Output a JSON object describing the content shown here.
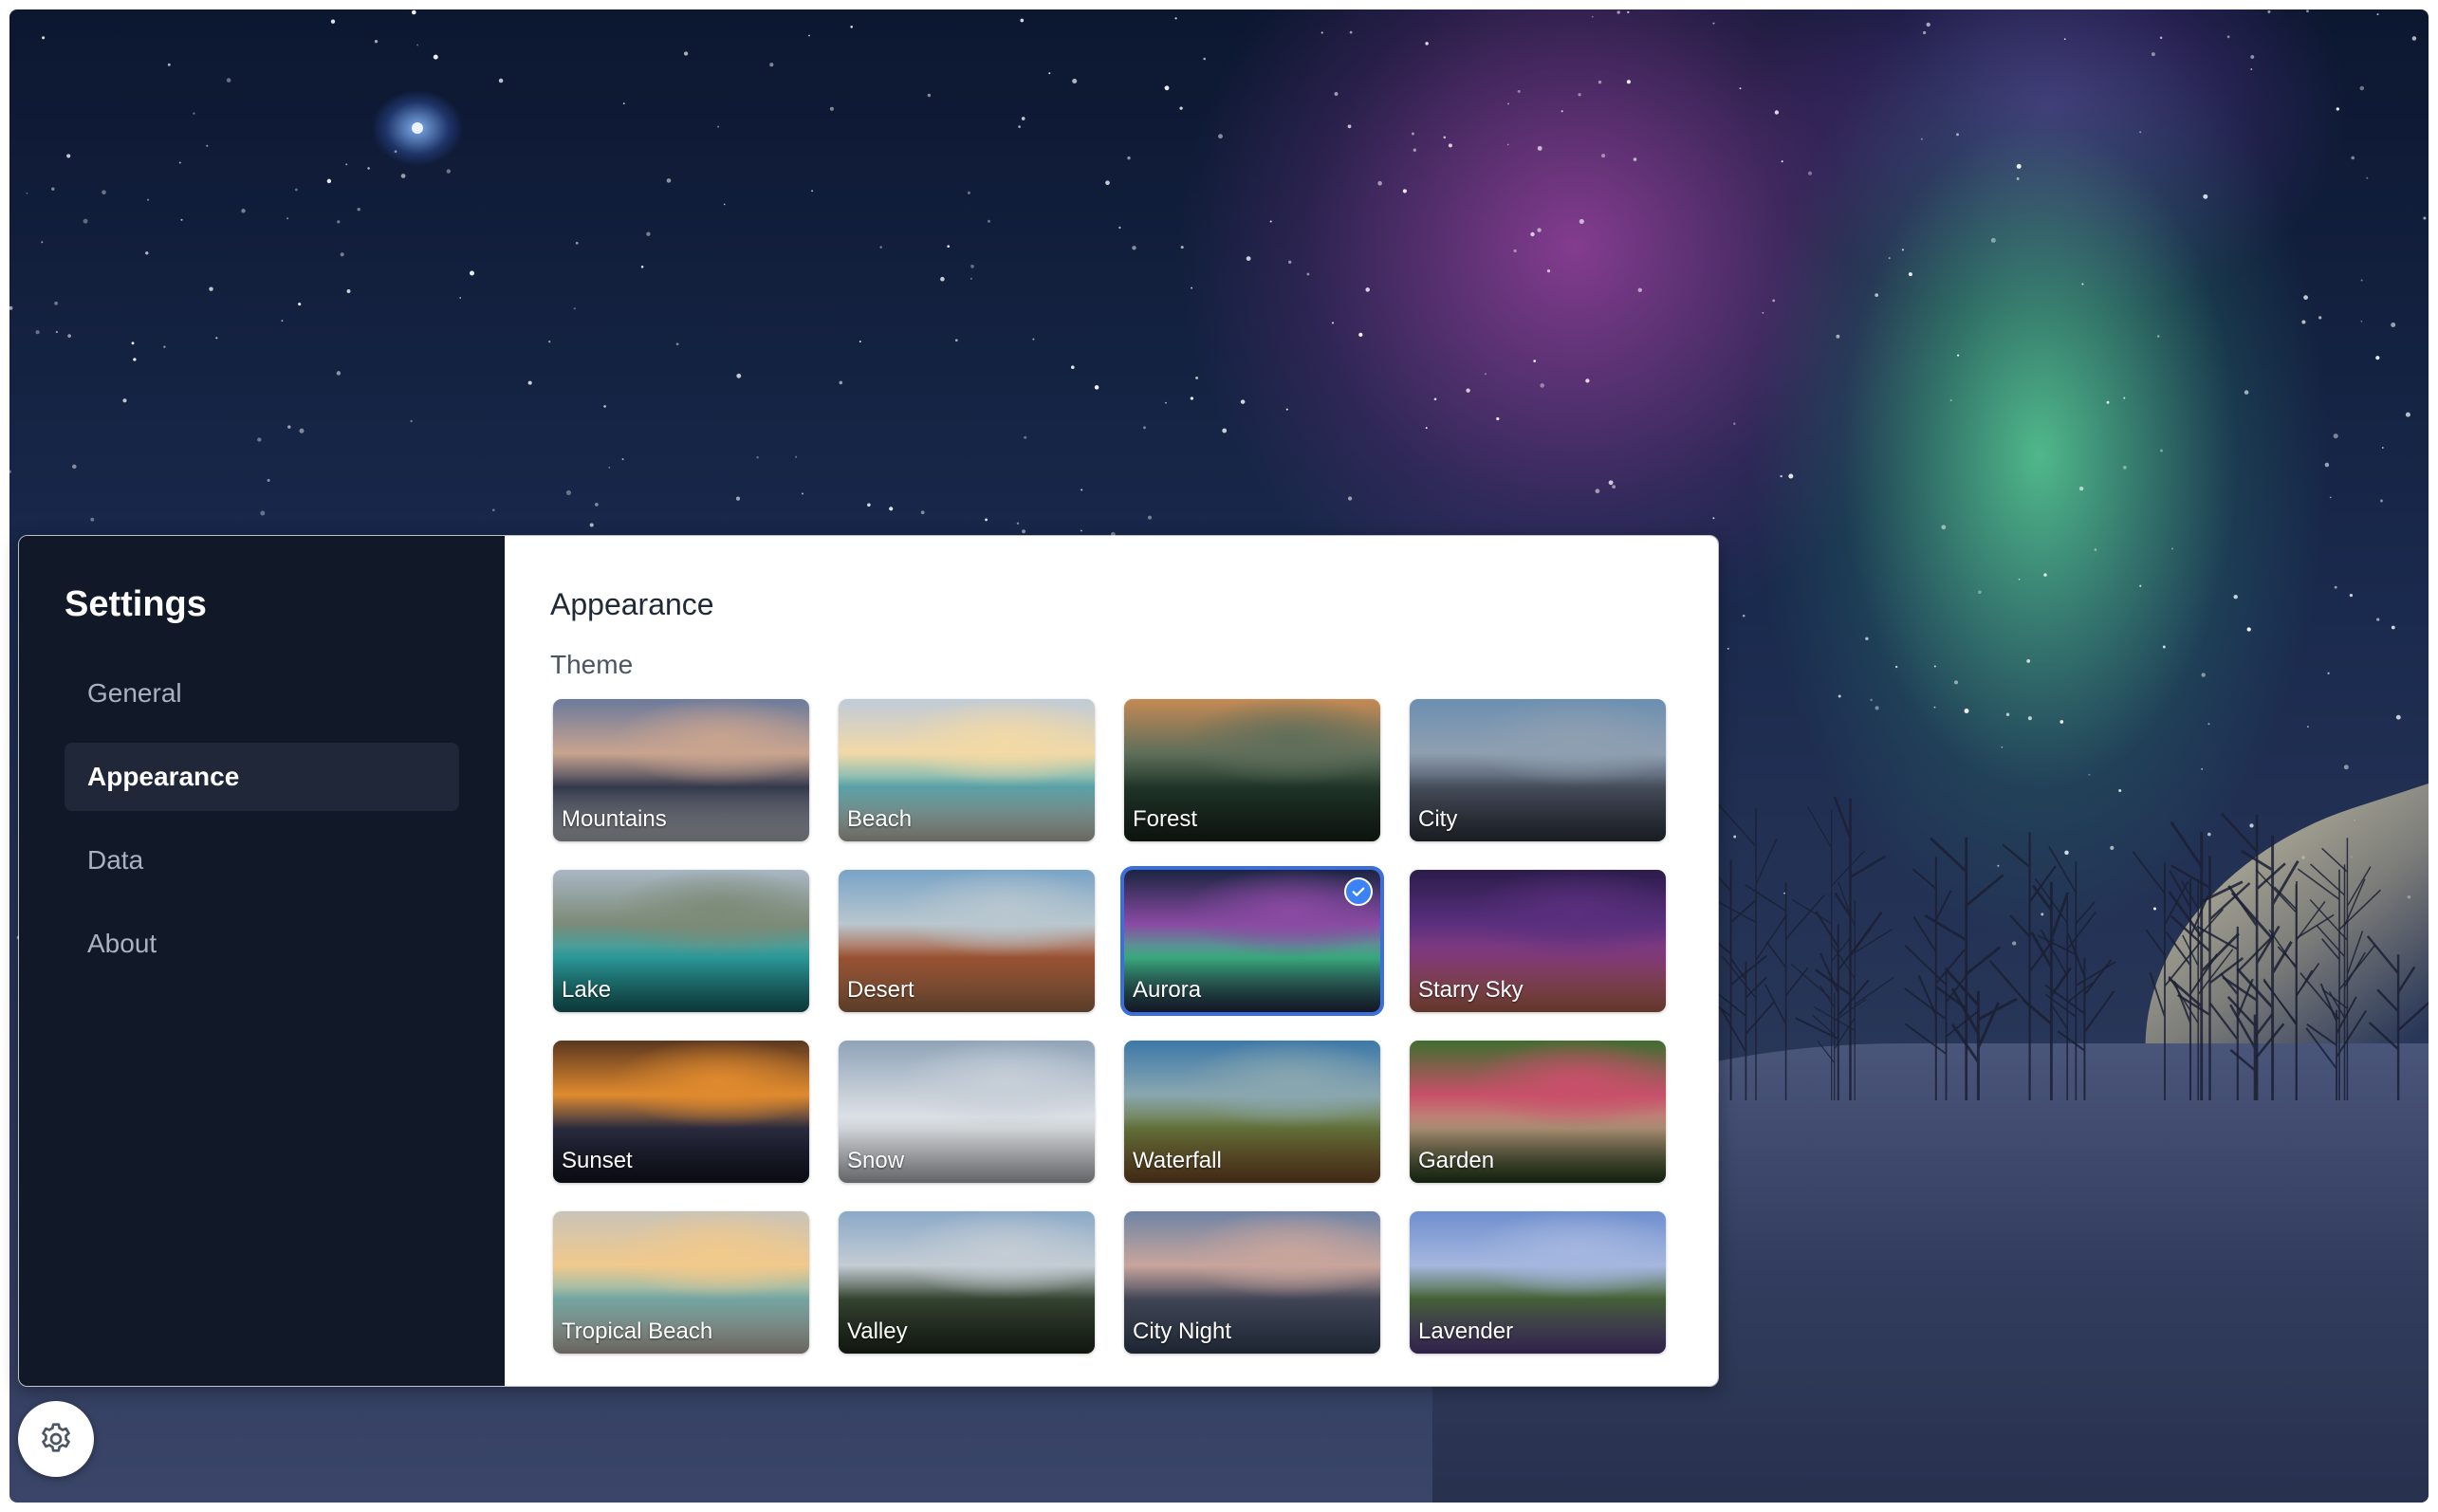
{
  "sidebar": {
    "title": "Settings",
    "items": [
      {
        "label": "General",
        "active": false
      },
      {
        "label": "Appearance",
        "active": true
      },
      {
        "label": "Data",
        "active": false
      },
      {
        "label": "About",
        "active": false
      }
    ]
  },
  "main": {
    "title": "Appearance",
    "section_label": "Theme",
    "selected_theme": "Aurora",
    "themes": [
      {
        "label": "Mountains",
        "colors": [
          "#6b7a9c",
          "#c9a48f",
          "#3a4055",
          "#d8dbe3"
        ]
      },
      {
        "label": "Beach",
        "colors": [
          "#bfcbd8",
          "#f2d9a6",
          "#63b3b8",
          "#e9e2d6"
        ]
      },
      {
        "label": "Forest",
        "colors": [
          "#c58a54",
          "#5f6e5a",
          "#233a2c",
          "#1c2a20"
        ]
      },
      {
        "label": "City",
        "colors": [
          "#6b8fb1",
          "#8f9fb1",
          "#4d5564",
          "#383e4a"
        ]
      },
      {
        "label": "Lake",
        "colors": [
          "#a9b7c4",
          "#7c8a77",
          "#2fa8a8",
          "#1d7a7c"
        ]
      },
      {
        "label": "Desert",
        "colors": [
          "#78a3c6",
          "#b9c7cf",
          "#a95a37",
          "#c48358"
        ]
      },
      {
        "label": "Aurora",
        "colors": [
          "#1b2542",
          "#8a4aa3",
          "#3fb98a",
          "#2a3452"
        ]
      },
      {
        "label": "Starry Sky",
        "colors": [
          "#2b1c4a",
          "#5a2f7d",
          "#8d3f82",
          "#d6775e"
        ]
      },
      {
        "label": "Sunset",
        "colors": [
          "#5a3720",
          "#e08a2e",
          "#2e2f45",
          "#161a2a"
        ]
      },
      {
        "label": "Snow",
        "colors": [
          "#8fa3b8",
          "#c7cfd8",
          "#e7eaee",
          "#d9dde2"
        ]
      },
      {
        "label": "Waterfall",
        "colors": [
          "#3c78a8",
          "#8aa7b0",
          "#6b7a3d",
          "#8a5a2e"
        ]
      },
      {
        "label": "Garden",
        "colors": [
          "#3f6e2f",
          "#c8506a",
          "#b89a7c",
          "#2c4a23"
        ]
      },
      {
        "label": "Tropical Beach",
        "colors": [
          "#c9c3b8",
          "#f0c98c",
          "#7fb6b3",
          "#e3dbcf"
        ]
      },
      {
        "label": "Valley",
        "colors": [
          "#8aa9c8",
          "#c4ccd4",
          "#3a4a36",
          "#263323"
        ]
      },
      {
        "label": "City Night",
        "colors": [
          "#6f84a6",
          "#c8a59c",
          "#474c5e",
          "#40506c"
        ]
      },
      {
        "label": "Lavender",
        "colors": [
          "#6f8fcf",
          "#a5b7df",
          "#4b6a3c",
          "#6a4b9e"
        ]
      }
    ]
  },
  "colors": {
    "sidebar_bg": "#111827",
    "nav_active_bg": "#1f2738",
    "accent": "#3b6fe0",
    "check_badge": "#3b82f6"
  },
  "icons": {
    "settings_fab": "gear-icon",
    "selected_badge": "checkmark-icon"
  }
}
